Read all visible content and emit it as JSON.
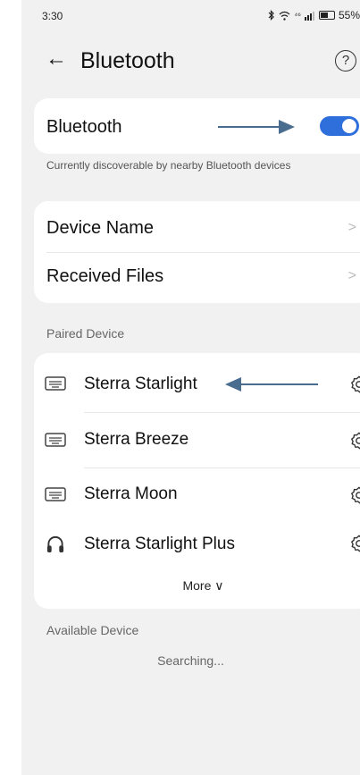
{
  "status_bar": {
    "time": "3:30",
    "network": "⁴⁶",
    "battery": "55%",
    "icons": [
      "bluetooth-icon",
      "wifi-icon",
      "signal-icon",
      "battery-icon"
    ]
  },
  "header": {
    "back_icon": "←",
    "title": "Bluetooth",
    "help_icon": "?"
  },
  "bluetooth_toggle": {
    "label": "Bluetooth",
    "enabled": true,
    "caption": "Currently discoverable by nearby Bluetooth devices"
  },
  "settings": {
    "items": [
      {
        "label": "Device Name",
        "chevron": ">"
      },
      {
        "label": "Received Files",
        "chevron": ">"
      }
    ]
  },
  "paired": {
    "title": "Paired Device",
    "devices": [
      {
        "name": "Sterra Starlight",
        "icon": "keyboard-icon"
      },
      {
        "name": "Sterra Breeze",
        "icon": "keyboard-icon"
      },
      {
        "name": "Sterra Moon",
        "icon": "keyboard-icon"
      },
      {
        "name": "Sterra Starlight Plus",
        "icon": "headphones-icon"
      }
    ],
    "more_label": "More ∨"
  },
  "available": {
    "title": "Available Device",
    "status": "Searching..."
  },
  "colors": {
    "accent": "#2f6fdc",
    "annotation_arrow": "#4a6c8f",
    "background": "#f1f1f1",
    "card": "#ffffff"
  }
}
